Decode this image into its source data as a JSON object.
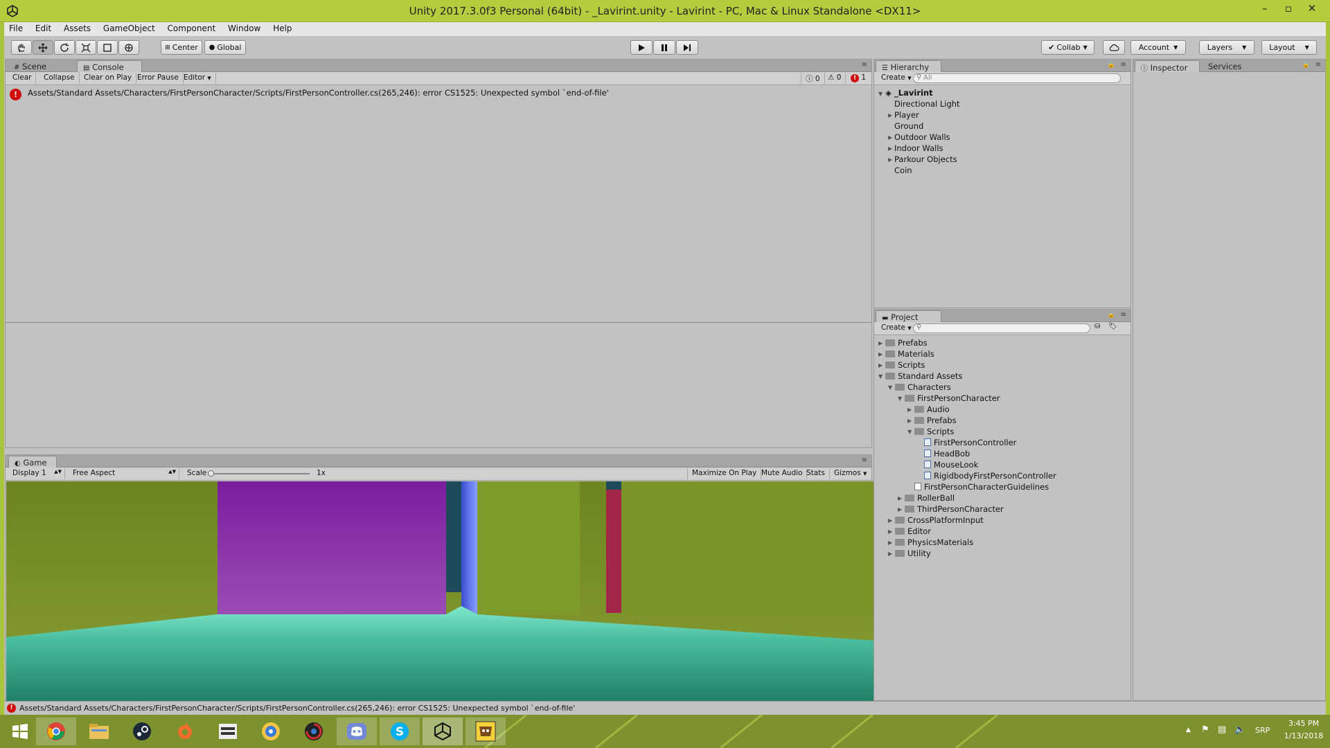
{
  "window": {
    "title": "Unity 2017.3.0f3 Personal (64bit) - _Lavirint.unity - Lavirint - PC, Mac & Linux Standalone <DX11>"
  },
  "menu": [
    "File",
    "Edit",
    "Assets",
    "GameObject",
    "Component",
    "Window",
    "Help"
  ],
  "toolbar": {
    "pivot_label": "Center",
    "space_label": "Global",
    "collab_label": "Collab",
    "account_label": "Account",
    "layers_label": "Layers",
    "layout_label": "Layout"
  },
  "console": {
    "tabs": [
      "Scene",
      "Console"
    ],
    "buttons": [
      "Clear",
      "Collapse",
      "Clear on Play",
      "Error Pause",
      "Editor"
    ],
    "counts": {
      "info": "0",
      "warnings": "0",
      "errors": "1"
    },
    "error_message": "Assets/Standard Assets/Characters/FirstPersonCharacter/Scripts/FirstPersonController.cs(265,246): error CS1525: Unexpected symbol `end-of-file'"
  },
  "game": {
    "tab": "Game",
    "display": "Display 1",
    "aspect": "Free Aspect",
    "scale_label": "Scale",
    "scale_value": "1x",
    "options": [
      "Maximize On Play",
      "Mute Audio",
      "Stats",
      "Gizmos"
    ]
  },
  "hierarchy": {
    "tab": "Hierarchy",
    "create_label": "Create",
    "search_placeholder": "All",
    "scene_name": "_Lavirint",
    "items": [
      "Directional Light",
      "Player",
      "Ground",
      "Outdoor Walls",
      "Indoor Walls",
      "Parkour Objects",
      "Coin"
    ]
  },
  "inspector": {
    "tabs": [
      "Inspector",
      "Services"
    ]
  },
  "project": {
    "tab": "Project",
    "create_label": "Create",
    "items": [
      "Prefabs",
      "Materials",
      "Scripts",
      "Standard Assets",
      "Characters",
      "FirstPersonCharacter",
      "Audio",
      "Prefabs",
      "Scripts",
      "FirstPersonController",
      "HeadBob",
      "MouseLook",
      "RigidbodyFirstPersonController",
      "FirstPersonCharacterGuidelines",
      "RollerBall",
      "ThirdPersonCharacter",
      "CrossPlatformInput",
      "Editor",
      "PhysicsMaterials",
      "Utility"
    ]
  },
  "status": {
    "message": "Assets/Standard Assets/Characters/FirstPersonCharacter/Scripts/FirstPersonController.cs(265,246): error CS1525: Unexpected symbol `end-of-file'"
  },
  "taskbar": {
    "apps": [
      "windows-start",
      "chrome",
      "file-explorer",
      "steam",
      "origin",
      "media-player",
      "gaming-app",
      "uplay",
      "discord",
      "skype",
      "unity",
      "game-app"
    ],
    "language": "SRP",
    "time": "3:45 PM",
    "date": "1/13/2018"
  },
  "colors": {
    "accent": "#b5cc3e",
    "error": "#d10c0c",
    "panel": "#c2c2c2"
  }
}
